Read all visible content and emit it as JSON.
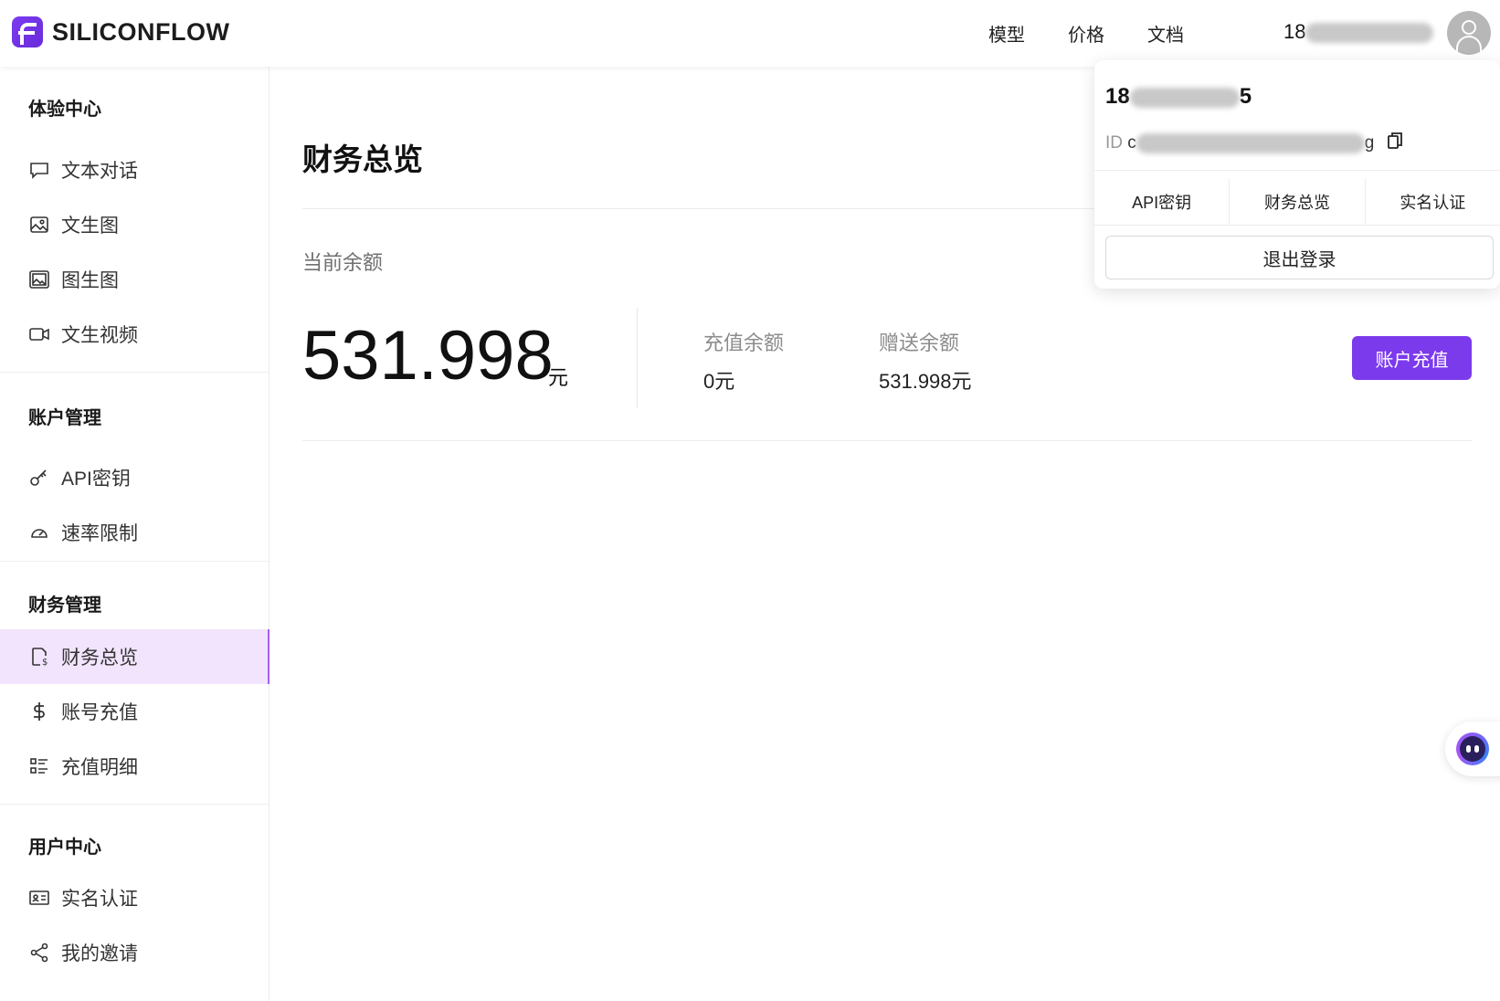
{
  "brand": {
    "name": "SILICONFLOW",
    "accent": "#7c3aed"
  },
  "topnav": {
    "items": [
      "模型",
      "价格",
      "文档"
    ],
    "user_phone_prefix": "18"
  },
  "sidebar": {
    "groups": [
      {
        "title": "体验中心",
        "items": [
          "文本对话",
          "文生图",
          "图生图",
          "文生视频"
        ]
      },
      {
        "title": "账户管理",
        "items": [
          "API密钥",
          "速率限制"
        ]
      },
      {
        "title": "财务管理",
        "items": [
          "财务总览",
          "账号充值",
          "充值明细"
        ]
      },
      {
        "title": "用户中心",
        "items": [
          "实名认证",
          "我的邀请"
        ]
      }
    ],
    "active_item": "财务总览"
  },
  "main": {
    "title": "财务总览",
    "current_balance_label": "当前余额",
    "balance_value": "531.998",
    "balance_unit": "元",
    "recharge_label": "充值余额",
    "recharge_value": "0元",
    "gift_label": "赠送余额",
    "gift_value": "531.998元",
    "recharge_button": "账户充值"
  },
  "dropdown": {
    "phone_prefix": "18",
    "phone_suffix": "5",
    "id_label": "ID",
    "id_prefix": "c",
    "id_suffix": "g",
    "tabs": [
      "API密钥",
      "财务总览",
      "实名认证"
    ],
    "logout": "退出登录"
  },
  "icons": {
    "chat": "chat-bubble-icon",
    "image": "image-icon",
    "image2": "image-to-image-icon",
    "video": "video-camera-icon",
    "key": "key-icon",
    "gauge": "gauge-icon",
    "bill": "bill-icon",
    "dollar": "dollar-icon",
    "list": "list-icon",
    "idcard": "id-card-icon",
    "share": "share-icon",
    "copy": "copy-icon",
    "avatar": "user-avatar-icon"
  }
}
